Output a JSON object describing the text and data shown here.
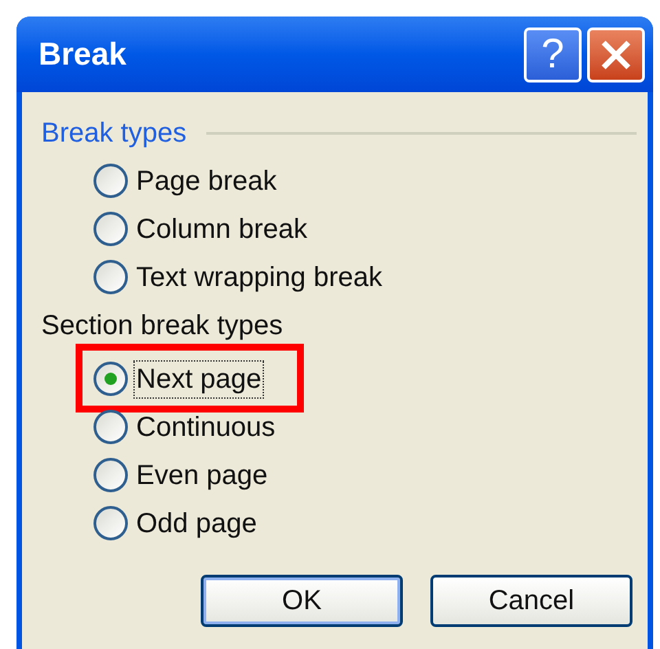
{
  "window": {
    "title": "Break"
  },
  "title_buttons": [
    {
      "kind": "help",
      "label": "?"
    },
    {
      "kind": "close"
    }
  ],
  "groups": [
    {
      "title": "Break types",
      "kind": "framed",
      "options": [
        {
          "label": "Page break",
          "selected": false,
          "focused": false,
          "highlighted": false
        },
        {
          "label": "Column break",
          "selected": false,
          "focused": false,
          "highlighted": false
        },
        {
          "label": "Text wrapping break",
          "selected": false,
          "focused": false,
          "highlighted": false
        }
      ]
    },
    {
      "title": "Section break types",
      "kind": "plain",
      "options": [
        {
          "label": "Next page",
          "selected": true,
          "focused": true,
          "highlighted": true
        },
        {
          "label": "Continuous",
          "selected": false,
          "focused": false,
          "highlighted": false
        },
        {
          "label": "Even page",
          "selected": false,
          "focused": false,
          "highlighted": false
        },
        {
          "label": "Odd page",
          "selected": false,
          "focused": false,
          "highlighted": false
        }
      ]
    }
  ],
  "buttons": [
    {
      "label": "OK",
      "default": true
    },
    {
      "label": "Cancel",
      "default": false
    }
  ]
}
